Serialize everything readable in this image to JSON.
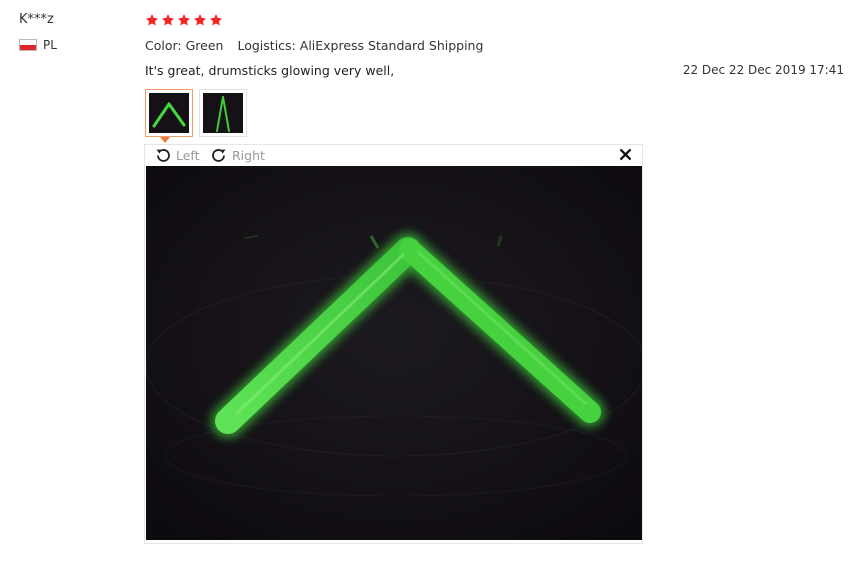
{
  "reviewer": {
    "name": "K***z",
    "country": "PL"
  },
  "rating": {
    "stars": 5,
    "max": 5
  },
  "details": {
    "color_label": "Color:",
    "color_value": "Green",
    "logistics_label": "Logistics:",
    "logistics_value": "AliExpress Standard Shipping"
  },
  "review_text": "It's great, drumsticks glowing very well,",
  "date": "22 Dec 22 Dec 2019 17:41",
  "viewer": {
    "rotate_left_label": "Left",
    "rotate_right_label": "Right"
  },
  "colors": {
    "star": "#f2282c",
    "accent": "#f27a3a",
    "glow": "#3fd13a"
  }
}
